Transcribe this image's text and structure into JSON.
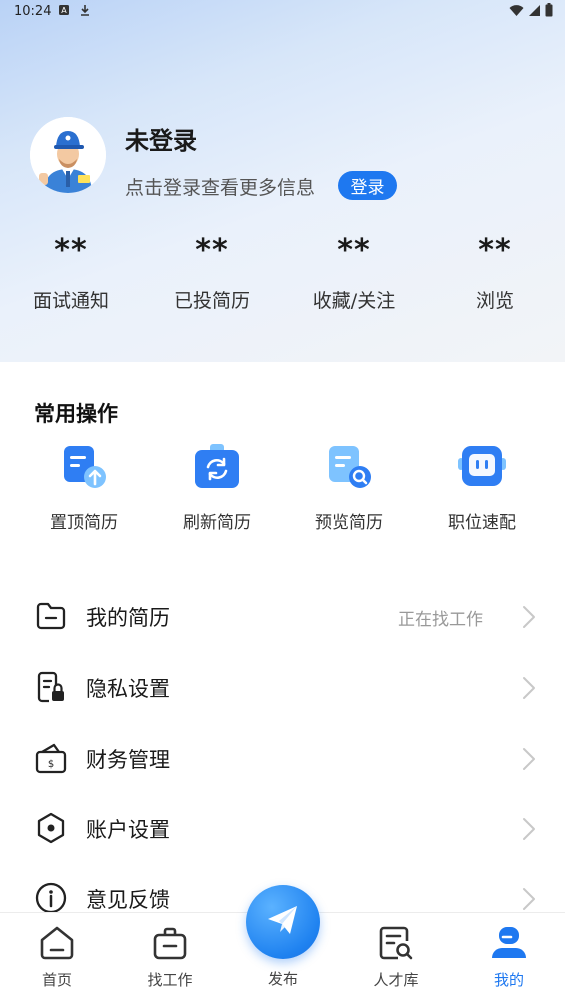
{
  "status_bar": {
    "time": "10:24"
  },
  "profile": {
    "name": "未登录",
    "hint": "点击登录查看更多信息",
    "login_label": "登录"
  },
  "stats": [
    {
      "value": "**",
      "label": "面试通知"
    },
    {
      "value": "**",
      "label": "已投简历"
    },
    {
      "value": "**",
      "label": "收藏/关注"
    },
    {
      "value": "**",
      "label": "浏览"
    }
  ],
  "quick_actions": {
    "title": "常用操作",
    "items": [
      {
        "label": "置顶简历",
        "icon": "resume-top-icon"
      },
      {
        "label": "刷新简历",
        "icon": "refresh-resume-icon"
      },
      {
        "label": "预览简历",
        "icon": "preview-resume-icon"
      },
      {
        "label": "职位速配",
        "icon": "job-match-icon"
      }
    ]
  },
  "menu": [
    {
      "label": "我的简历",
      "extra": "正在找工作",
      "icon": "folder-icon"
    },
    {
      "label": "隐私设置",
      "extra": "",
      "icon": "privacy-lock-icon"
    },
    {
      "label": "财务管理",
      "extra": "",
      "icon": "wallet-icon"
    },
    {
      "label": "账户设置",
      "extra": "",
      "icon": "hexagon-settings-icon"
    },
    {
      "label": "意见反馈",
      "extra": "",
      "icon": "info-icon"
    }
  ],
  "tabbar": {
    "items": [
      {
        "label": "首页",
        "icon": "home-icon"
      },
      {
        "label": "找工作",
        "icon": "briefcase-icon"
      },
      {
        "label": "发布",
        "icon": "paper-plane-icon"
      },
      {
        "label": "人才库",
        "icon": "talent-search-icon"
      },
      {
        "label": "我的",
        "icon": "profile-icon"
      }
    ],
    "active": "我的"
  },
  "colors": {
    "accent": "#1e78f0",
    "icon_blue": "#2f7ef3",
    "icon_light": "#7ec3ff"
  }
}
